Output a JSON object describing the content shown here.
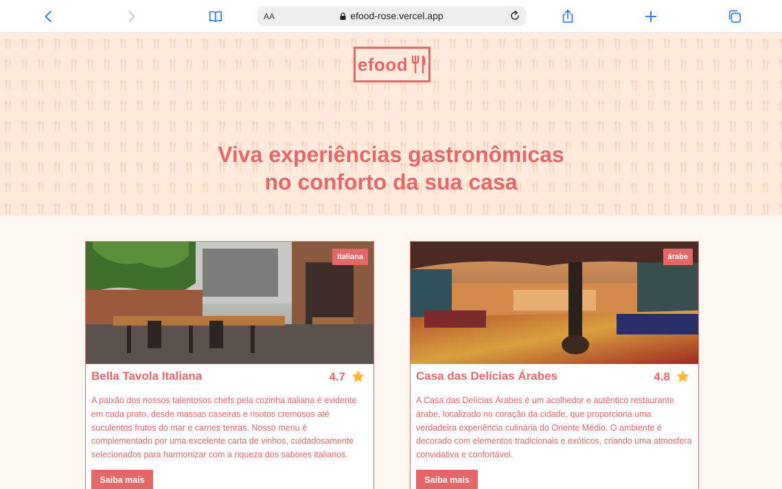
{
  "browser": {
    "text_size_label": "AA",
    "url": "efood-rose.vercel.app"
  },
  "hero": {
    "logo_text": "efood",
    "headline_line1": "Viva experiências gastronômicas",
    "headline_line2": "no conforto da sua casa"
  },
  "restaurants": [
    {
      "tag": "italiana",
      "name": "Bella Tavola Italiana",
      "rating": "4.7",
      "description": "A paixão dos nossos talentosos chefs pela cozinha italiana é evidente em cada prato, desde massas caseiras e risotos cremosos até suculentos frutos do mar e carnes tenras. Nosso menu é complementado por uma excelente carta de vinhos, cuidadosamente selecionados para harmonizar com a riqueza dos sabores italianos.",
      "button": "Saiba mais"
    },
    {
      "tag": "árabe",
      "name": "Casa das Delícias Árabes",
      "rating": "4.8",
      "description": "A Casa das Delícias Árabes é um acolhedor e autêntico restaurante árabe, localizado no coração da cidade, que proporciona uma verdadeira experiência culinária do Oriente Médio. O ambiente é decorado com elementos tradicionais e exóticos, criando uma atmosfera convidativa e confortável.",
      "button": "Saiba mais"
    }
  ],
  "colors": {
    "brand": "#e66767",
    "hero_bg": "#ffeadc",
    "page_bg": "#fff8f2",
    "star": "#ffb930",
    "browser_blue": "#1a73e8"
  }
}
